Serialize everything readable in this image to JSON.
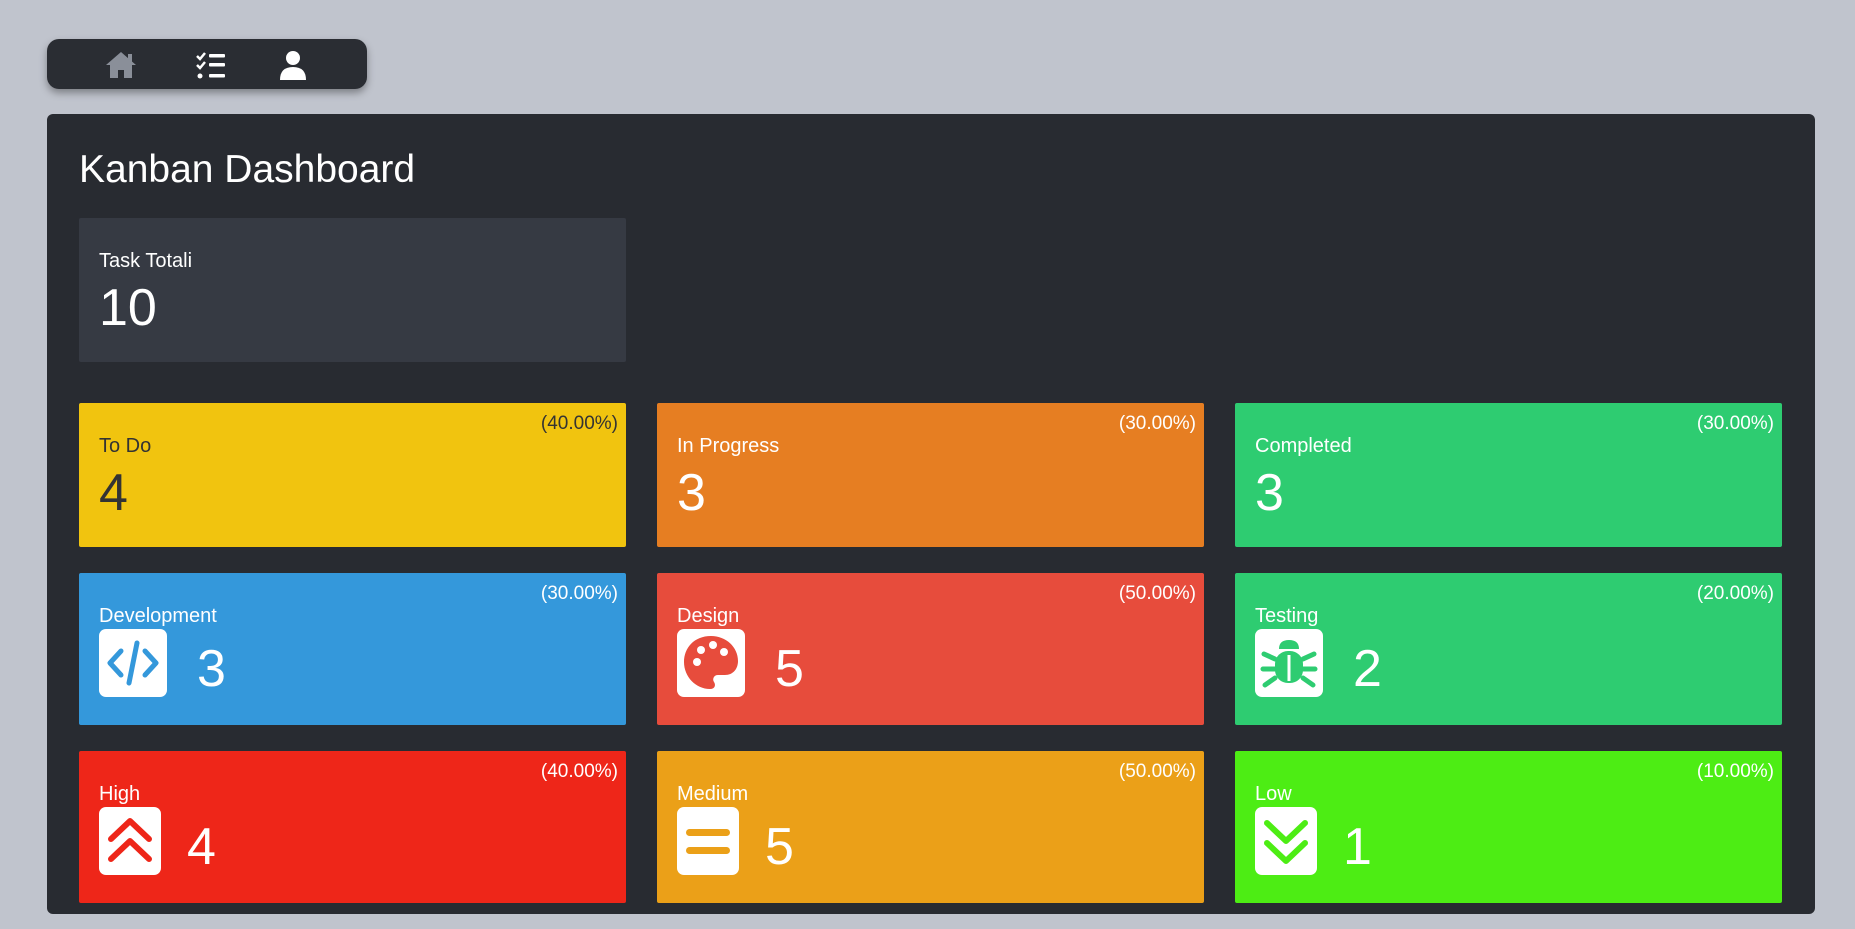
{
  "nav": {
    "items": [
      {
        "name": "home",
        "icon": "home-icon"
      },
      {
        "name": "tasks",
        "icon": "task-list-icon"
      },
      {
        "name": "profile",
        "icon": "user-icon"
      }
    ]
  },
  "dashboard": {
    "title": "Kanban Dashboard",
    "total": {
      "label": "Task Totali",
      "value": "10"
    },
    "status": [
      {
        "label": "To Do",
        "value": "4",
        "percent": "(40.00%)",
        "color": "#f1c40f"
      },
      {
        "label": "In Progress",
        "value": "3",
        "percent": "(30.00%)",
        "color": "#e67e22"
      },
      {
        "label": "Completed",
        "value": "3",
        "percent": "(30.00%)",
        "color": "#2ecc71"
      }
    ],
    "categories": [
      {
        "label": "Development",
        "value": "3",
        "percent": "(30.00%)",
        "color": "#3498db",
        "icon": "code-icon"
      },
      {
        "label": "Design",
        "value": "5",
        "percent": "(50.00%)",
        "color": "#e74c3c",
        "icon": "palette-icon"
      },
      {
        "label": "Testing",
        "value": "2",
        "percent": "(20.00%)",
        "color": "#2ecc71",
        "icon": "bug-icon"
      }
    ],
    "priorities": [
      {
        "label": "High",
        "value": "4",
        "percent": "(40.00%)",
        "color": "#ee2619",
        "icon": "double-chevron-up-icon"
      },
      {
        "label": "Medium",
        "value": "5",
        "percent": "(50.00%)",
        "color": "#eba018",
        "icon": "equals-icon"
      },
      {
        "label": "Low",
        "value": "1",
        "percent": "(10.00%)",
        "color": "#4ded14",
        "icon": "double-chevron-down-icon"
      }
    ]
  }
}
